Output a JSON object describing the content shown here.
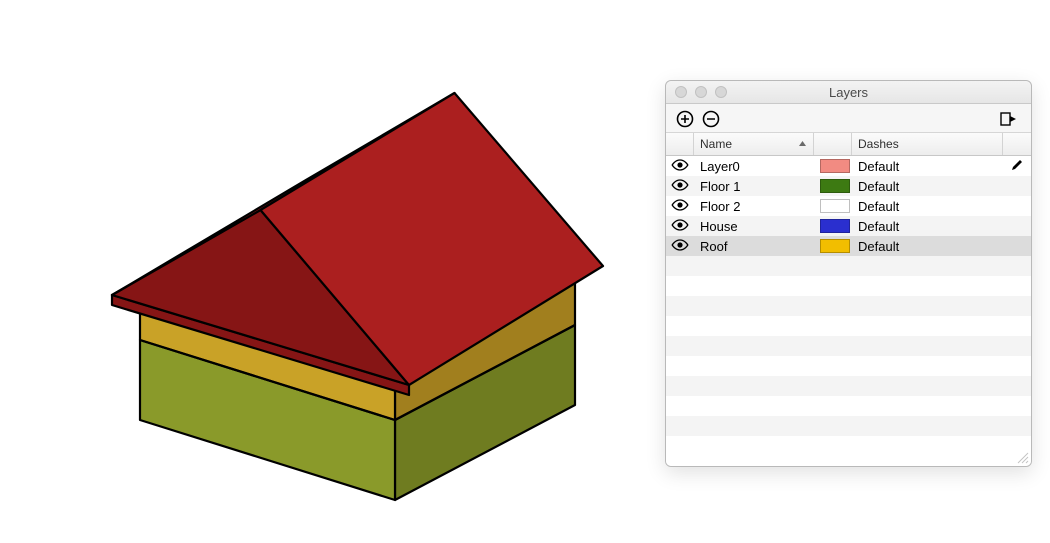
{
  "panel": {
    "title": "Layers",
    "columns": {
      "name": "Name",
      "dashes": "Dashes"
    },
    "icons": {
      "add": "plus-circle-icon",
      "remove": "minus-circle-icon",
      "send": "send-to-icon",
      "eye": "visibility-icon",
      "edit": "pencil-icon",
      "sort": "sort-asc-icon",
      "close": "close-icon",
      "minimize": "minimize-icon",
      "zoom": "zoom-icon"
    }
  },
  "layers": [
    {
      "name": "Layer0",
      "visible": true,
      "color": "#f28b82",
      "dashes": "Default",
      "editable": true,
      "selected": false
    },
    {
      "name": "Floor 1",
      "visible": true,
      "color": "#3d7a12",
      "dashes": "Default",
      "editable": false,
      "selected": false
    },
    {
      "name": "Floor 2",
      "visible": true,
      "color": "#ffffff",
      "dashes": "Default",
      "editable": false,
      "selected": false
    },
    {
      "name": "House",
      "visible": true,
      "color": "#2a2fcf",
      "dashes": "Default",
      "editable": false,
      "selected": false
    },
    {
      "name": "Roof",
      "visible": true,
      "color": "#f2be00",
      "dashes": "Default",
      "editable": false,
      "selected": true
    }
  ],
  "model": {
    "colors": {
      "roof_top": "#ab1f1f",
      "roof_side": "#861515",
      "wall_upper_front": "#c9a227",
      "wall_upper_side": "#a17f1e",
      "wall_lower_front": "#8a9a2a",
      "wall_lower_side": "#6f7c20",
      "edge": "#000000"
    }
  }
}
